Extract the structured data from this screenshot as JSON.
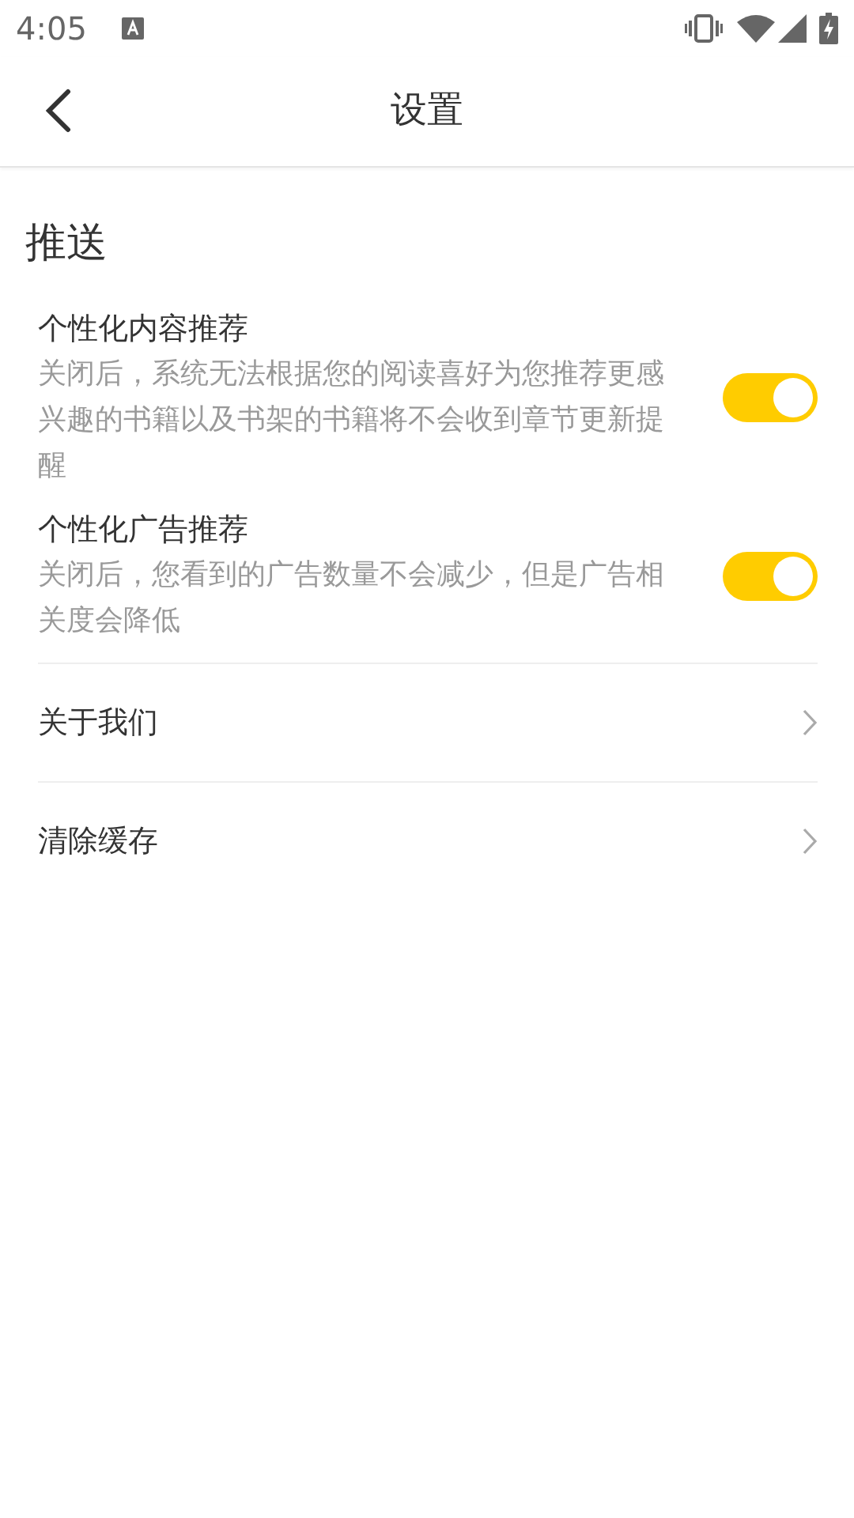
{
  "status_bar": {
    "time": "4:05"
  },
  "header": {
    "title": "设置"
  },
  "section": {
    "title": "推送"
  },
  "toggles": [
    {
      "title": "个性化内容推荐",
      "description": "关闭后，系统无法根据您的阅读喜好为您推荐更感兴趣的书籍以及书架的书籍将不会收到章节更新提醒",
      "on": true
    },
    {
      "title": "个性化广告推荐",
      "description": "关闭后，您看到的广告数量不会减少，但是广告相关度会降低",
      "on": true
    }
  ],
  "links": [
    {
      "label": "关于我们"
    },
    {
      "label": "清除缓存"
    }
  ]
}
